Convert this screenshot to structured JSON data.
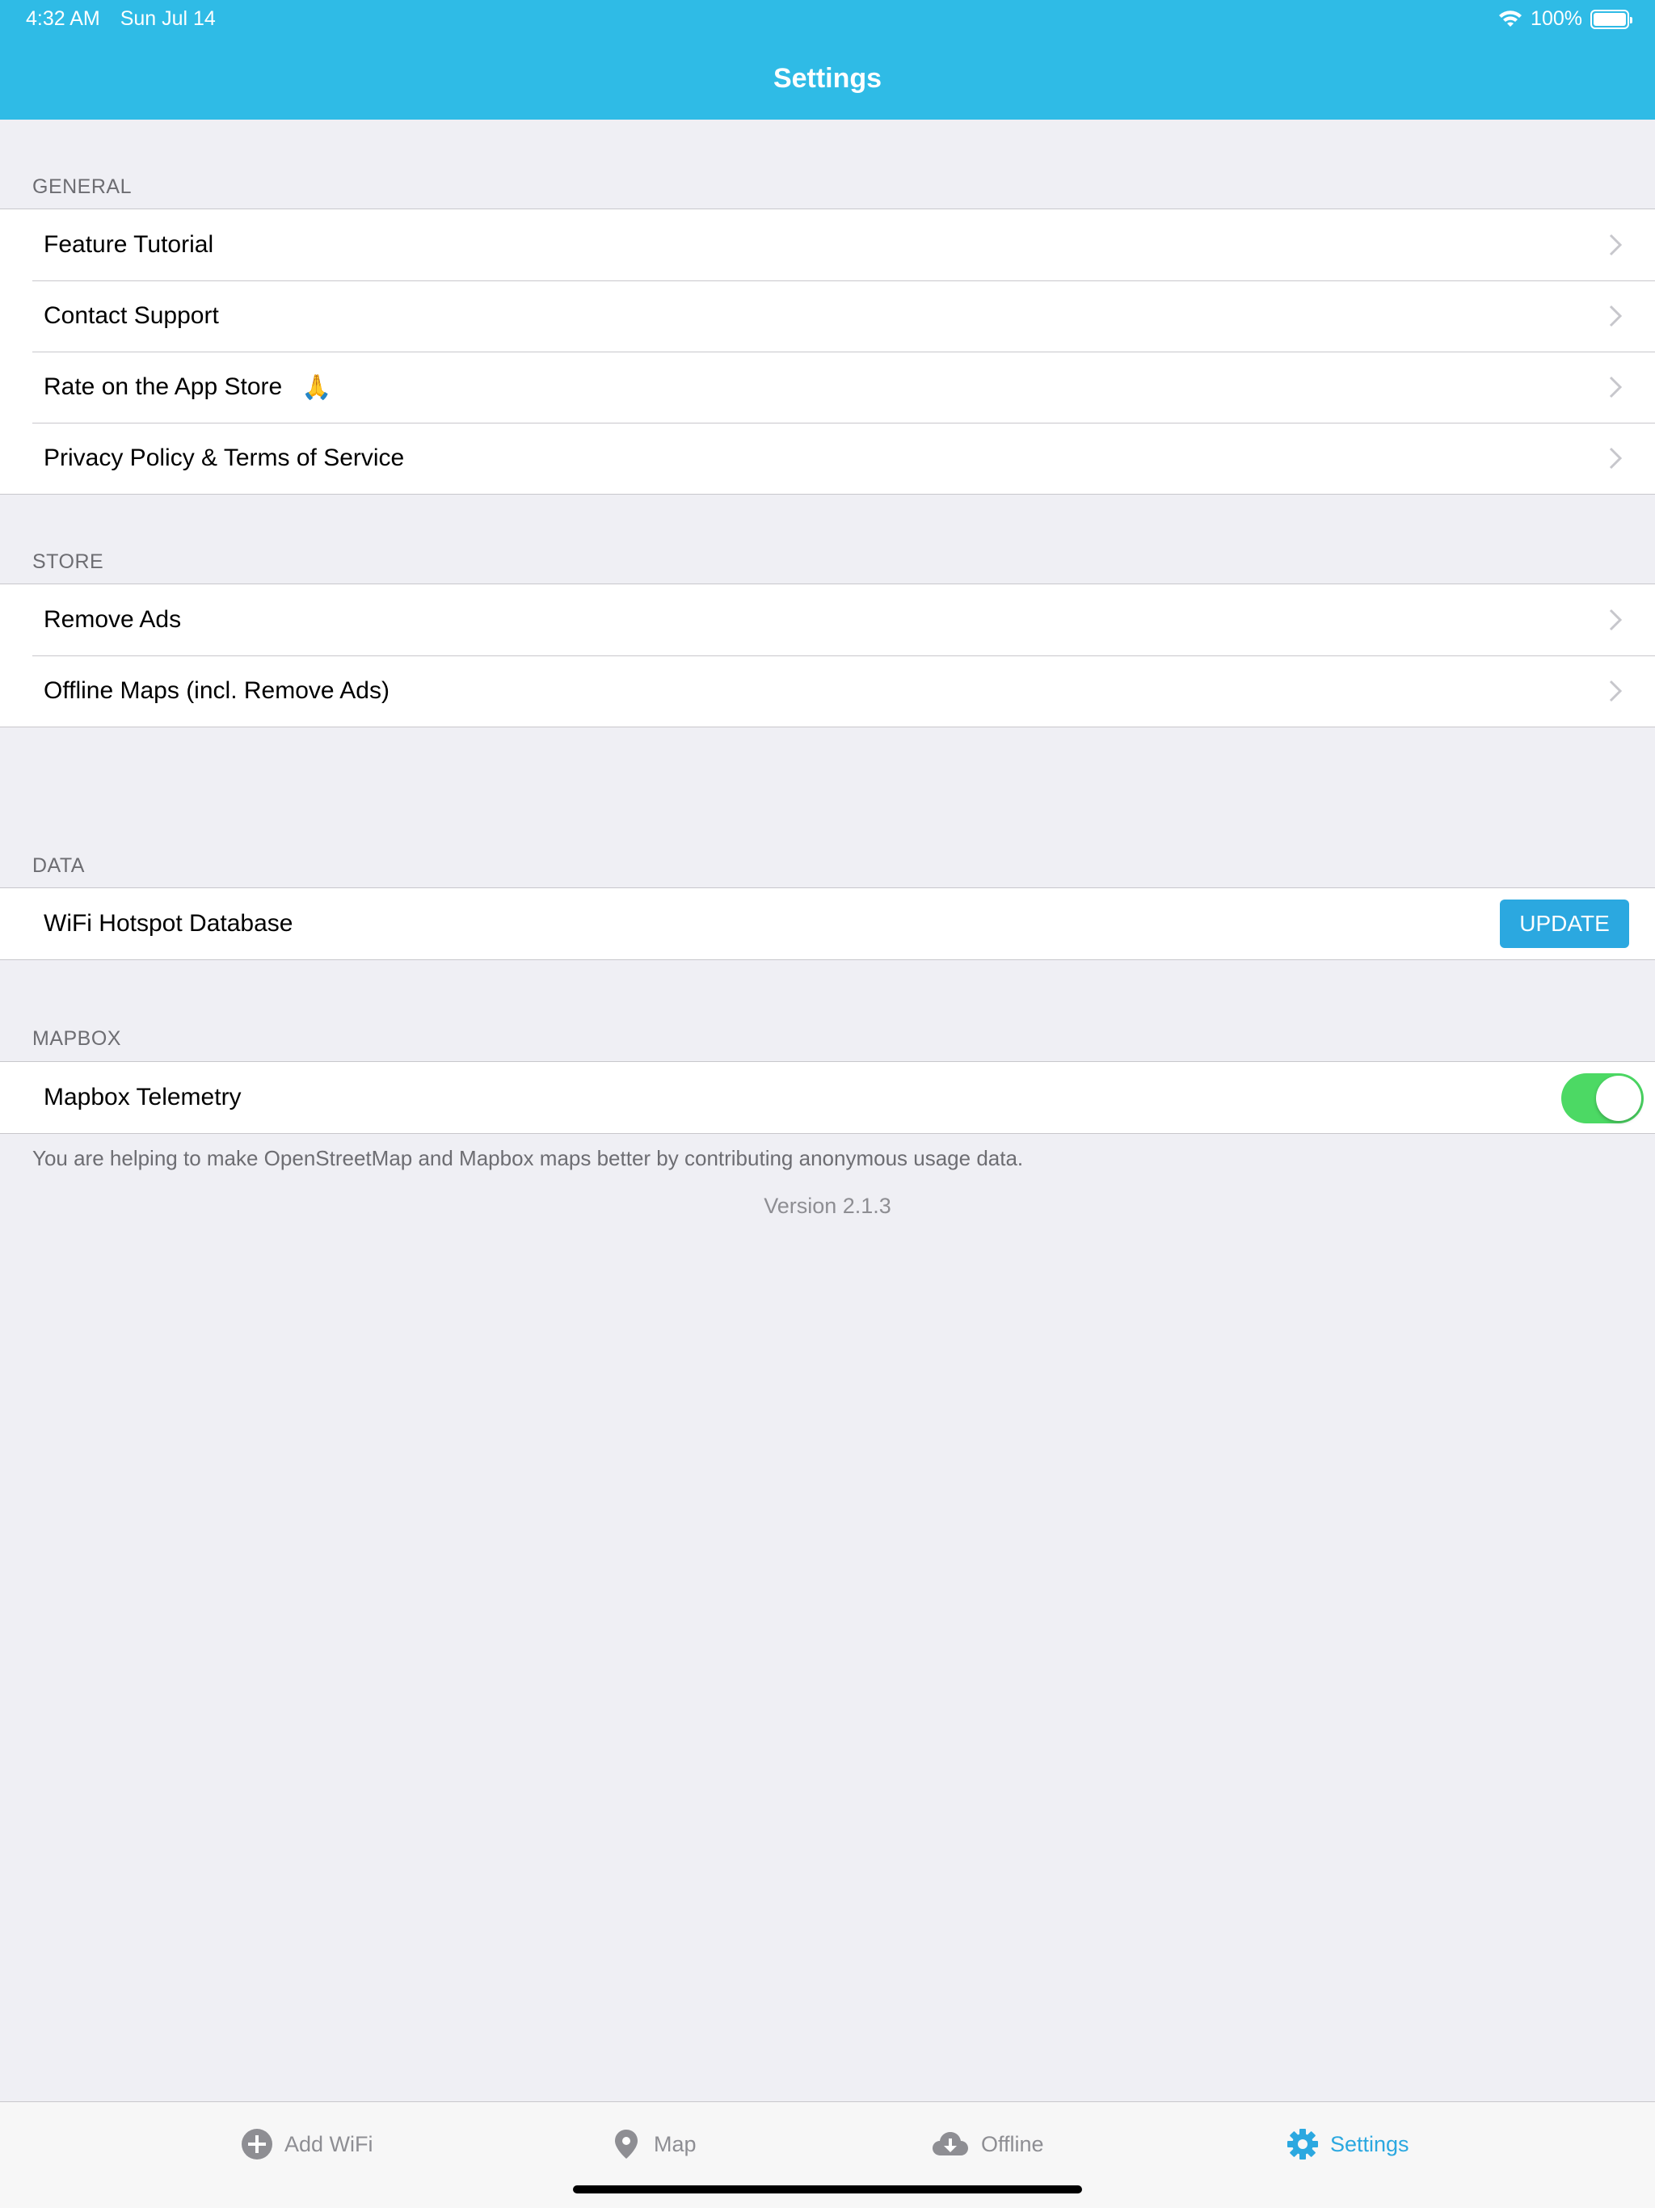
{
  "status_bar": {
    "time": "4:32 AM",
    "date": "Sun Jul 14",
    "battery": "100%"
  },
  "nav": {
    "title": "Settings"
  },
  "sections": {
    "general": {
      "header": "GENERAL",
      "items": [
        {
          "label": "Feature Tutorial"
        },
        {
          "label": "Contact Support"
        },
        {
          "label": "Rate on the App Store",
          "emoji": "🙏"
        },
        {
          "label": "Privacy Policy & Terms of Service"
        }
      ]
    },
    "store": {
      "header": "STORE",
      "items": [
        {
          "label": "Remove Ads"
        },
        {
          "label": "Offline Maps (incl. Remove Ads)"
        }
      ]
    },
    "data": {
      "header": "DATA",
      "item_label": "WiFi Hotspot Database",
      "button_label": "UPDATE"
    },
    "mapbox": {
      "header": "MAPBOX",
      "item_label": "Mapbox Telemetry",
      "toggle_on": true,
      "footer": "You are helping to make OpenStreetMap and Mapbox maps better by contributing anonymous usage data."
    }
  },
  "version": "Version 2.1.3",
  "tab_bar": {
    "tabs": [
      {
        "label": "Add WiFi",
        "icon": "plus-circle-icon"
      },
      {
        "label": "Map",
        "icon": "map-pin-icon"
      },
      {
        "label": "Offline",
        "icon": "cloud-download-icon"
      },
      {
        "label": "Settings",
        "icon": "gear-icon",
        "active": true
      }
    ]
  },
  "colors": {
    "accent": "#2fbbe6",
    "toggle_on": "#4cd964",
    "button": "#2ba8e0"
  }
}
